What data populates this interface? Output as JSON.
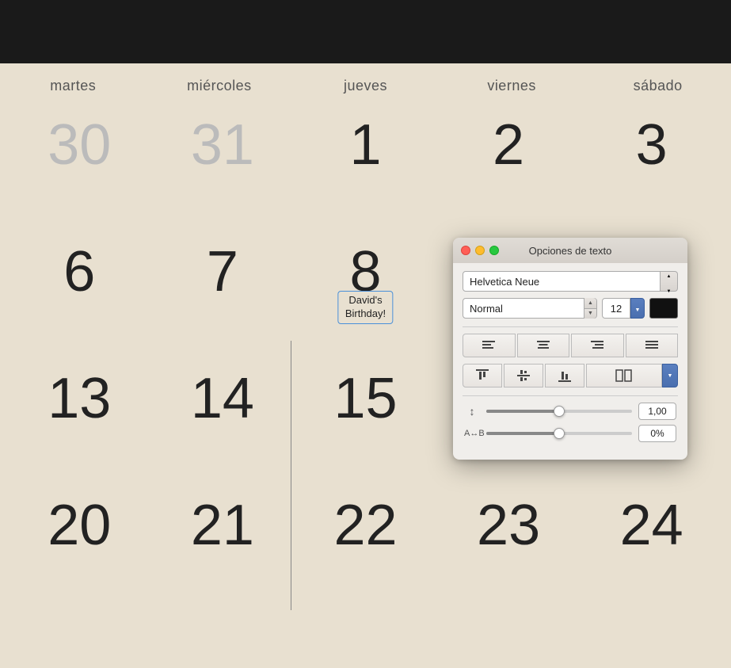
{
  "topbar": {
    "bg": "#1a1a1a"
  },
  "calendar": {
    "bg": "#e8e0d0",
    "day_headers": [
      "martes",
      "miércoles",
      "jueves",
      "viernes",
      "sábado"
    ],
    "weeks": [
      [
        {
          "number": "30",
          "faded": true
        },
        {
          "number": "31",
          "faded": true
        },
        {
          "number": "1",
          "faded": false
        },
        {
          "number": "2",
          "faded": false
        },
        {
          "number": "3",
          "faded": false
        }
      ],
      [
        {
          "number": "6",
          "faded": false
        },
        {
          "number": "7",
          "faded": false
        },
        {
          "number": "8",
          "faded": false,
          "event": "David's Birthday!"
        },
        {
          "number": "",
          "faded": false
        },
        {
          "number": "",
          "faded": false
        }
      ],
      [
        {
          "number": "13",
          "faded": false
        },
        {
          "number": "14",
          "faded": false
        },
        {
          "number": "15",
          "faded": false
        },
        {
          "number": "",
          "faded": false
        },
        {
          "number": "",
          "faded": false
        }
      ],
      [
        {
          "number": "20",
          "faded": false
        },
        {
          "number": "21",
          "faded": false
        },
        {
          "number": "22",
          "faded": false
        },
        {
          "number": "23",
          "faded": false
        },
        {
          "number": "24",
          "faded": false
        }
      ]
    ]
  },
  "panel": {
    "title": "Opciones de texto",
    "font_name": "Helvetica Neue",
    "font_style": "Normal",
    "font_size": "12",
    "line_spacing_value": "1,00",
    "char_spacing_value": "0%",
    "align_buttons": [
      "≡",
      "≡",
      "≡",
      "≡"
    ],
    "valign_buttons": [
      "⊤",
      "⊥",
      "↓"
    ],
    "line_spacing_icon": "↕",
    "char_spacing_label": "A↔B"
  }
}
